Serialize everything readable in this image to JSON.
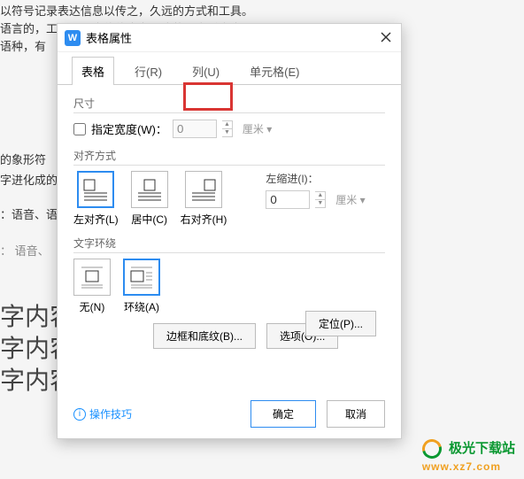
{
  "background": {
    "line1": "以符号记录表达信息以传之，久远的方式和工具。",
    "line2": "语言的，工具，人类往往先有口头的语言后产生面",
    "line3": "语种，有",
    "line4": "的象形符",
    "line5": "字进化成的",
    "line6": "：语音、语",
    "line7": "： 语音、",
    "cell1": "字内容",
    "cell2": "字内容",
    "cell3": "字内容"
  },
  "dialog": {
    "title": "表格属性",
    "tabs": {
      "table": "表格",
      "row": "行(R)",
      "column": "列(U)",
      "cell": "单元格(E)"
    },
    "size": {
      "legend": "尺寸",
      "specify_width": "指定宽度(W)：",
      "width_value": "0",
      "width_unit": "厘米"
    },
    "align": {
      "legend": "对齐方式",
      "left": "左对齐(L)",
      "center": "居中(C)",
      "right": "右对齐(H)",
      "indent_label": "左缩进(I)：",
      "indent_value": "0",
      "indent_unit": "厘米"
    },
    "wrap": {
      "legend": "文字环绕",
      "none": "无(N)",
      "around": "环绕(A)"
    },
    "buttons": {
      "position": "定位(P)...",
      "border_shading": "边框和底纹(B)...",
      "options": "选项(O)...",
      "tips": "操作技巧",
      "ok": "确定",
      "cancel": "取消"
    }
  },
  "watermark": {
    "name": "极光下载站",
    "url": "www.xz7.com"
  }
}
